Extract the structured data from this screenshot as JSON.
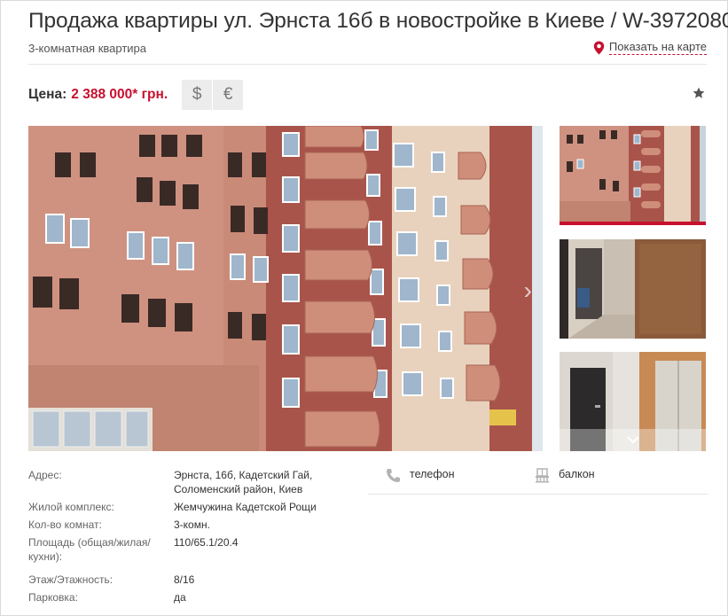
{
  "listing": {
    "title": "Продажа квартиры ул. Эрнста 16б в новостройке в Киеве / W-3972080",
    "subtitle": "3-комнатная квартира",
    "map_link_label": "Показать на карте"
  },
  "price": {
    "label": "Цена:",
    "value": "2 388 000* грн.",
    "currency_usd": "$",
    "currency_eur": "€"
  },
  "icons": {
    "map": "map-pin-icon",
    "favorite": "star-icon",
    "phone": "phone-icon",
    "balcony": "balcony-icon",
    "scroll_down": "chevron-down-icon",
    "next": "chevron-right-icon"
  },
  "colors": {
    "accent": "#c8102e",
    "text": "#333333",
    "muted": "#666666",
    "button_bg": "#ececec"
  },
  "details": [
    {
      "label": "Адрес:",
      "value_lines": [
        "Эрнста, 16б, Кадетский Гай,",
        "Соломенский район, Киев"
      ]
    },
    {
      "label": "Жилой комплекс:",
      "value_lines": [
        "Жемчужина Кадетской Рощи"
      ]
    },
    {
      "label": "Кол-во комнат:",
      "value_lines": [
        "3-комн."
      ]
    },
    {
      "label_lines": [
        "Площадь (общая/жилая/",
        "кухни):"
      ],
      "value_lines": [
        "110/65.1/20.4"
      ]
    },
    {
      "label": "Этаж/Этажность:",
      "value_lines": [
        "8/16"
      ]
    },
    {
      "label": "Парковка:",
      "value_lines": [
        "да"
      ]
    }
  ],
  "features": [
    {
      "icon": "phone-icon",
      "label": "телефон"
    },
    {
      "icon": "balcony-icon",
      "label": "балкон"
    }
  ]
}
